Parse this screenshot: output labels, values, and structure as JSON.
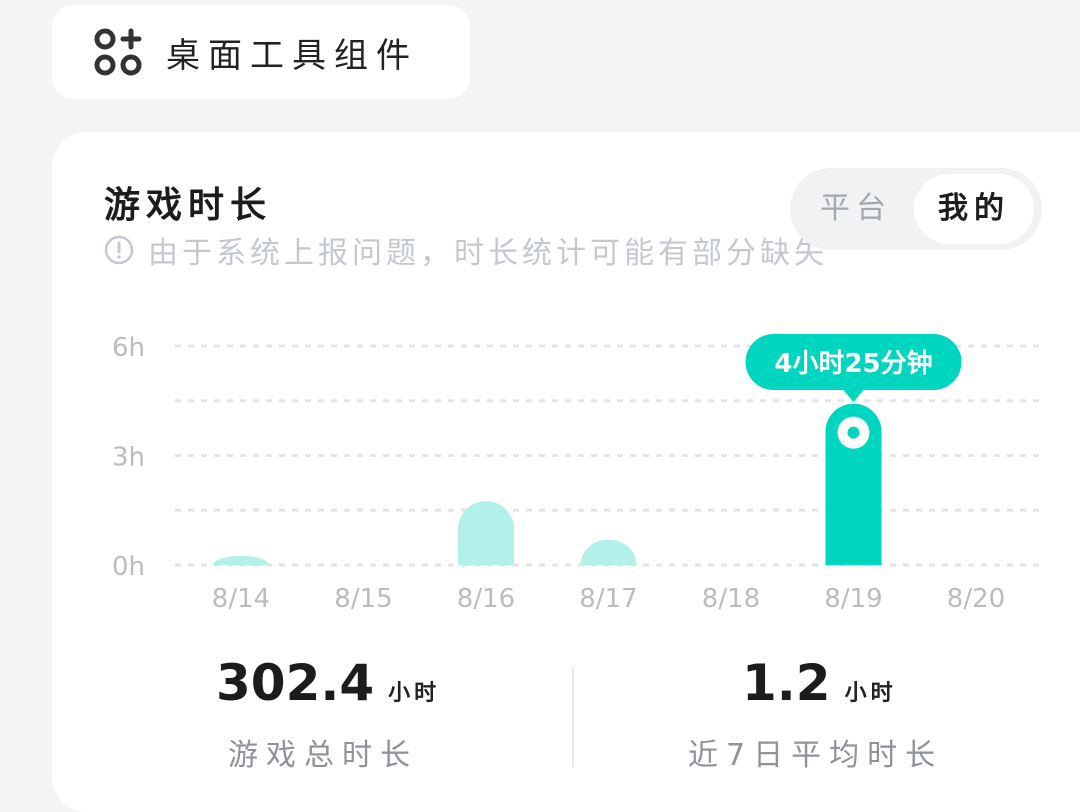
{
  "widget": {
    "label": "桌面工具组件",
    "icon": "widgets-add-icon"
  },
  "card": {
    "title": "游戏时长",
    "notice": "由于系统上报问题，时长统计可能有部分缺失",
    "toggle": {
      "platform": "平台",
      "mine": "我的",
      "selected": "我的"
    }
  },
  "chart_data": {
    "type": "bar",
    "categories": [
      "8/14",
      "8/15",
      "8/16",
      "8/17",
      "8/18",
      "8/19",
      "8/20"
    ],
    "values": [
      0.25,
      0,
      1.75,
      0.7,
      0,
      4.42,
      0
    ],
    "y_ticks": [
      "0h",
      "3h",
      "6h"
    ],
    "ylim": [
      0,
      6
    ],
    "highlight_index": 5,
    "tooltip": "4小时25分钟",
    "colors": {
      "bar": "#b2f0ea",
      "highlight": "#00d5bf",
      "grid": "#e3e5e8",
      "tick": "#b8bdc2"
    }
  },
  "stats": {
    "total": {
      "value": "302.4",
      "unit": "小时",
      "label": "游戏总时长"
    },
    "avg": {
      "value": "1.2",
      "unit": "小时",
      "label": "近7日平均时长"
    }
  }
}
